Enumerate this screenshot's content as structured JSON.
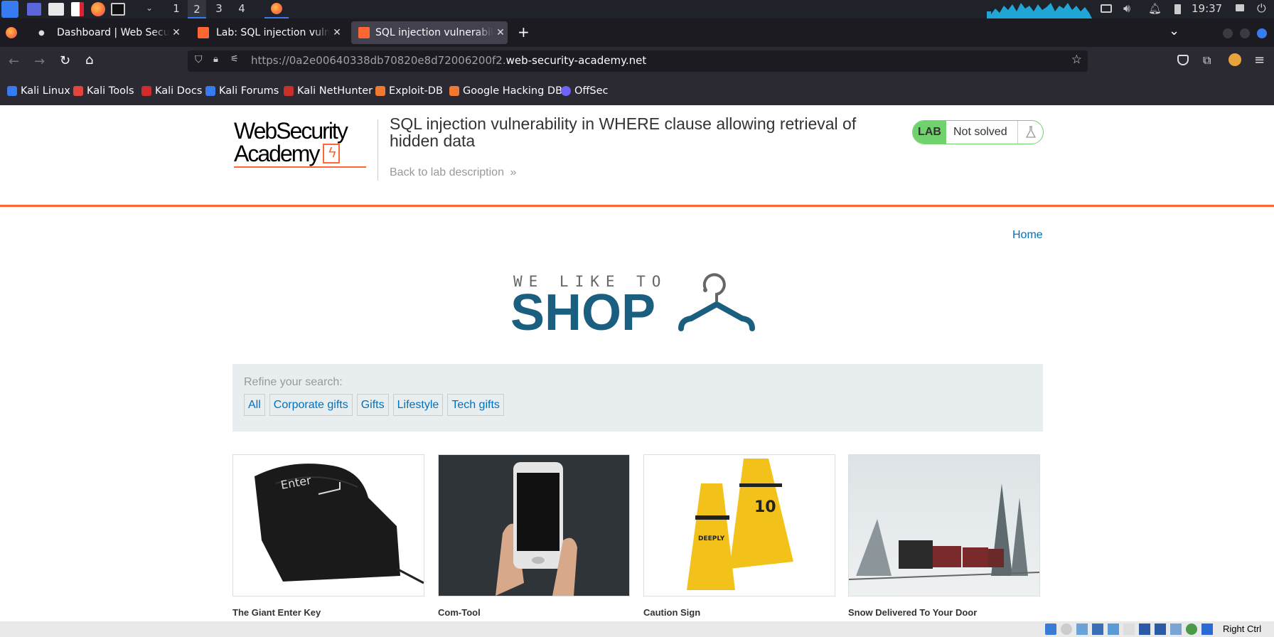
{
  "taskbar": {
    "workspaces": [
      "1",
      "2",
      "3",
      "4"
    ],
    "active_workspace": "2",
    "clock": "19:37"
  },
  "browser": {
    "tabs": [
      {
        "title": "Dashboard | Web Security"
      },
      {
        "title": "Lab: SQL injection vulnera"
      },
      {
        "title": "SQL injection vulnerabilit"
      }
    ],
    "url_prefix": "https://0a2e00640338db70820e8d72006200f2.",
    "url_domain": "web-security-academy.net",
    "bookmarks": [
      {
        "label": "Kali Linux",
        "color": "#367bf0"
      },
      {
        "label": "Kali Tools",
        "color": "#e0463c"
      },
      {
        "label": "Kali Docs",
        "color": "#d12b2b"
      },
      {
        "label": "Kali Forums",
        "color": "#367bf0"
      },
      {
        "label": "Kali NetHunter",
        "color": "#c8302c"
      },
      {
        "label": "Exploit-DB",
        "color": "#f07a2f"
      },
      {
        "label": "Google Hacking DB",
        "color": "#f07a2f"
      },
      {
        "label": "OffSec",
        "color": "#6b64f5"
      }
    ]
  },
  "page": {
    "logo_line1": "WebSecurity",
    "logo_line2": "Academy",
    "lab_title": "SQL injection vulnerability in WHERE clause allowing retrieval of hidden data",
    "back_link": "Back to lab description",
    "badge_lab": "LAB",
    "badge_status": "Not solved",
    "home_link": "Home",
    "banner_small": "WE LIKE TO",
    "banner_big": "SHOP",
    "refine_label": "Refine your search:",
    "filters": [
      "All",
      "Corporate gifts",
      "Gifts",
      "Lifestyle",
      "Tech gifts"
    ],
    "products": [
      {
        "name": "The Giant Enter Key"
      },
      {
        "name": "Com-Tool"
      },
      {
        "name": "Caution Sign"
      },
      {
        "name": "Snow Delivered To Your Door"
      }
    ]
  },
  "statusbar": {
    "host_key": "Right Ctrl"
  },
  "colors": {
    "accent_orange": "#ff6633",
    "link_blue": "#0071bc",
    "badge_green": "#70d16d",
    "shop_blue": "#1a5f7f"
  }
}
